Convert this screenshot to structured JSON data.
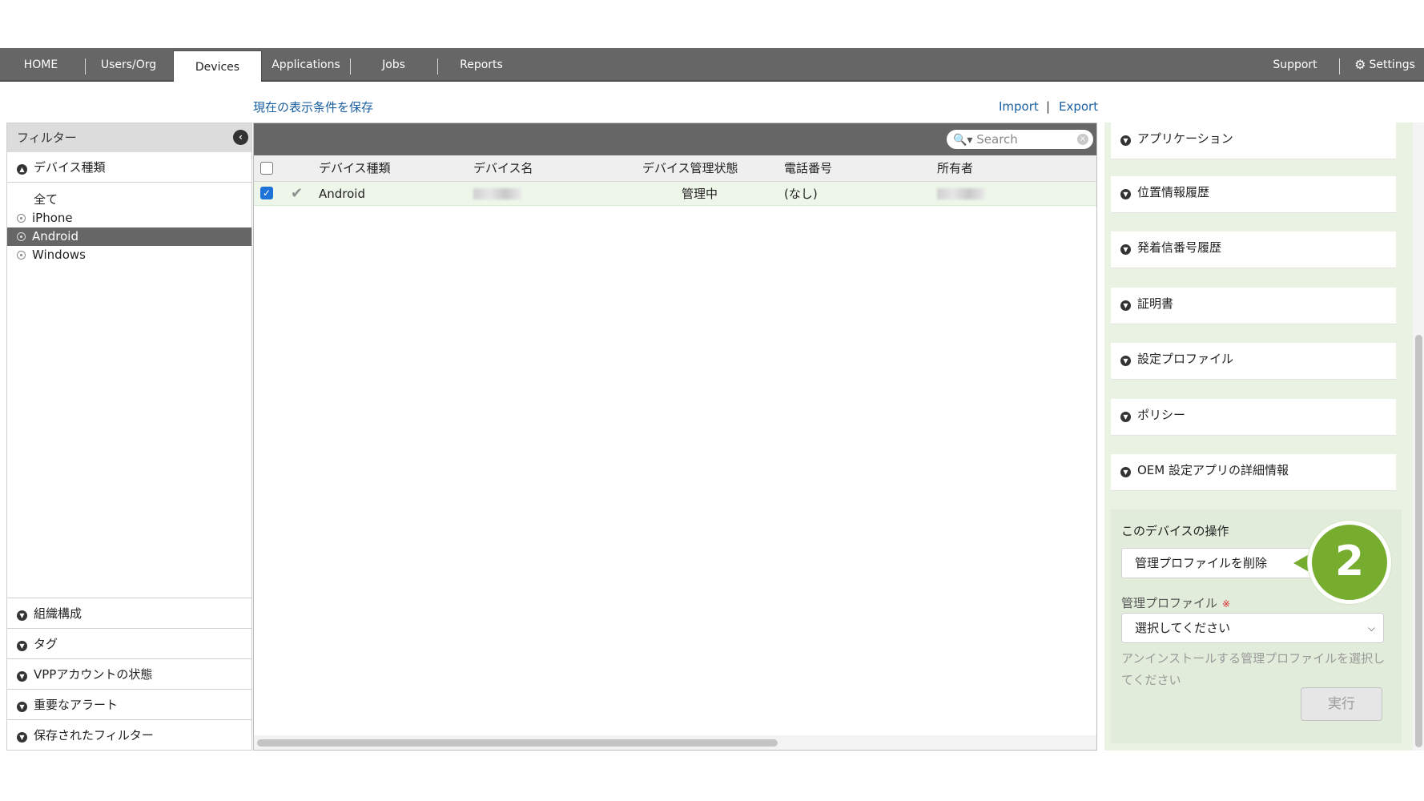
{
  "nav": {
    "home": "HOME",
    "users_org": "Users/Org",
    "devices": "Devices",
    "applications": "Applications",
    "jobs": "Jobs",
    "reports": "Reports",
    "support": "Support",
    "settings": "Settings"
  },
  "toolbar": {
    "save_view": "現在の表示条件を保存",
    "import": "Import",
    "separator": "|",
    "export": "Export"
  },
  "filter": {
    "title": "フィルター",
    "device_type_section": "デバイス種類",
    "device_types": [
      "全て",
      "iPhone",
      "Android",
      "Windows"
    ],
    "selected_device_type": "Android",
    "bottom_sections": [
      "組織構成",
      "タグ",
      "VPPアカウントの状態",
      "重要なアラート",
      "保存されたフィルター"
    ]
  },
  "table": {
    "search_placeholder": "Search",
    "columns": [
      "デバイス種類",
      "デバイス名",
      "デバイス管理状態",
      "電話番号",
      "所有者"
    ],
    "rows": [
      {
        "checked": true,
        "device_type": "Android",
        "device_name": "",
        "status": "管理中",
        "phone": "(なし)",
        "owner": ""
      }
    ]
  },
  "details": {
    "sections": [
      "アプリケーション",
      "位置情報履歴",
      "発着信番号履歴",
      "証明書",
      "設定プロファイル",
      "ポリシー",
      "OEM 設定アプリの詳細情報"
    ]
  },
  "actions": {
    "title": "このデバイスの操作",
    "remove_profile_button": "管理プロファイルを削除",
    "profile_label": "管理プロファイル",
    "required_mark": "※",
    "select_value": "選択してください",
    "hint": "アンインストールする管理プロファイルを選択してください",
    "run_button": "実行"
  },
  "callout": {
    "number": "2"
  },
  "colors": {
    "nav_bg": "#666666",
    "link": "#1a5fa0",
    "accent_green": "#77ad2e",
    "selected_row": "#eef6ea"
  }
}
